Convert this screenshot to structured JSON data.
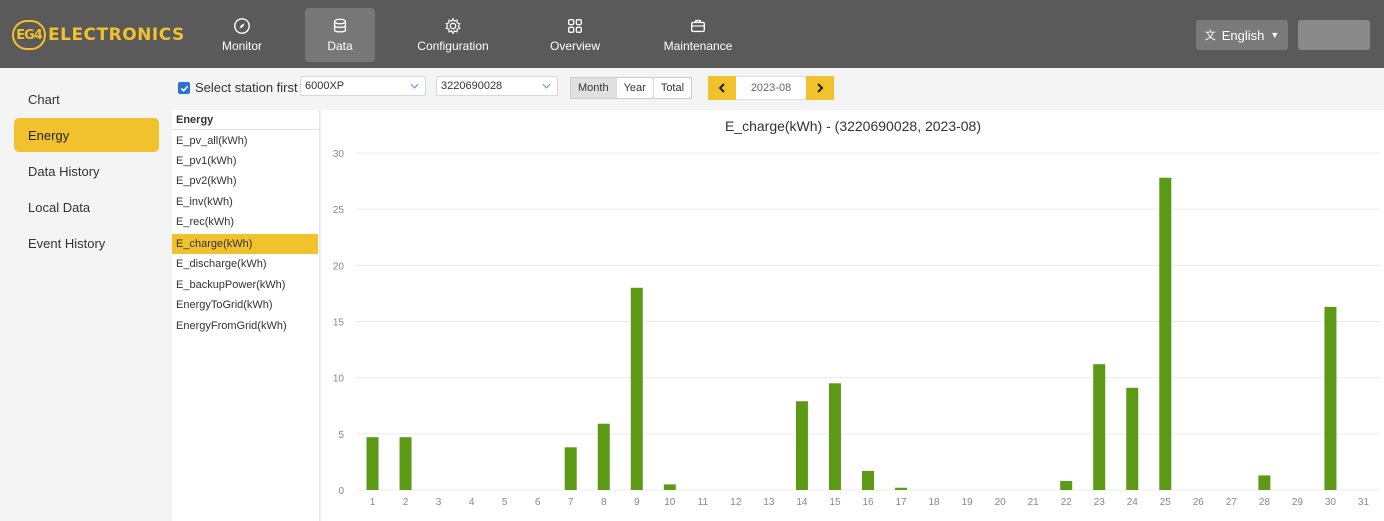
{
  "header": {
    "logo_badge": "EG4",
    "logo_text": "ELECTRONICS",
    "nav": [
      {
        "label": "Monitor",
        "icon": "compass-icon"
      },
      {
        "label": "Data",
        "icon": "database-icon"
      },
      {
        "label": "Configuration",
        "icon": "gear-icon"
      },
      {
        "label": "Overview",
        "icon": "grid-icon"
      },
      {
        "label": "Maintenance",
        "icon": "briefcase-icon"
      }
    ],
    "active_nav": "Data",
    "language": "English"
  },
  "sidebar": {
    "items": [
      {
        "label": "Chart"
      },
      {
        "label": "Energy"
      },
      {
        "label": "Data History"
      },
      {
        "label": "Local Data"
      },
      {
        "label": "Event History"
      }
    ],
    "active": "Energy"
  },
  "toolbar": {
    "select_station_label": "Select station first",
    "select_station_checked": true,
    "station_value": "6000XP",
    "device_value": "3220690028",
    "periods": [
      "Month",
      "Year",
      "Total"
    ],
    "active_period": "Month",
    "date": "2023-08"
  },
  "series_list": {
    "header": "Energy",
    "items": [
      "E_pv_all(kWh)",
      "E_pv1(kWh)",
      "E_pv2(kWh)",
      "E_inv(kWh)",
      "E_rec(kWh)",
      "E_charge(kWh)",
      "E_discharge(kWh)",
      "E_backupPower(kWh)",
      "EnergyToGrid(kWh)",
      "EnergyFromGrid(kWh)"
    ],
    "active": "E_charge(kWh)"
  },
  "chart_data": {
    "type": "bar",
    "title": "E_charge(kWh) - (3220690028, 2023-08)",
    "categories": [
      "1",
      "2",
      "3",
      "4",
      "5",
      "6",
      "7",
      "8",
      "9",
      "10",
      "11",
      "12",
      "13",
      "14",
      "15",
      "16",
      "17",
      "18",
      "19",
      "20",
      "21",
      "22",
      "23",
      "24",
      "25",
      "26",
      "27",
      "28",
      "29",
      "30",
      "31"
    ],
    "values": [
      4.7,
      4.7,
      0,
      0,
      0,
      0,
      3.8,
      5.9,
      18.0,
      0.5,
      0,
      0,
      0,
      7.9,
      9.5,
      1.7,
      0.2,
      0,
      0,
      0,
      0,
      0.8,
      11.2,
      9.1,
      27.8,
      0,
      0,
      1.3,
      0,
      16.3,
      0
    ],
    "ylim": [
      0,
      30
    ],
    "yticks": [
      0,
      5,
      10,
      15,
      20,
      25,
      30
    ],
    "bar_color": "#5c9a16",
    "grid": true
  },
  "colors": {
    "accent": "#f2c12e",
    "topbar": "#5a5a5a",
    "bar": "#5c9a16"
  }
}
